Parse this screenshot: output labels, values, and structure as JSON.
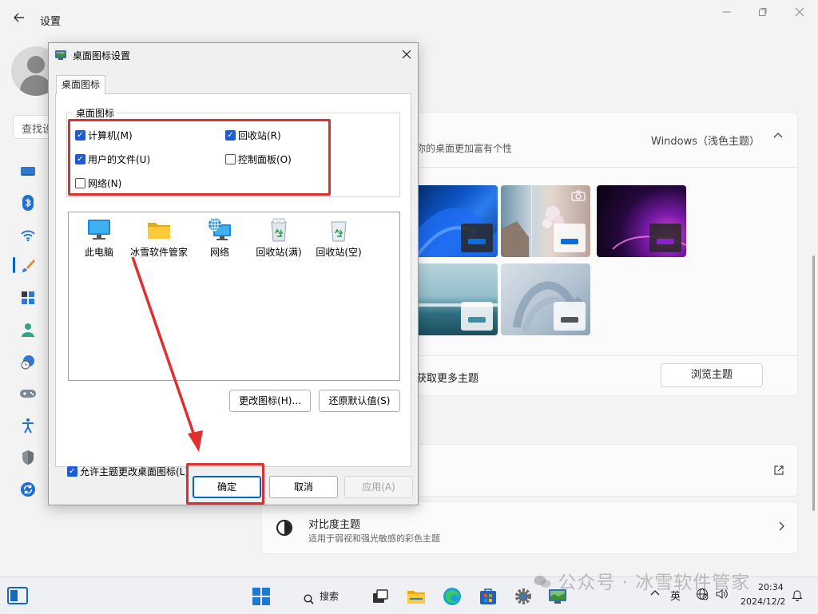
{
  "settings": {
    "title": "设置",
    "search_text": "查找设置",
    "theme": {
      "description": "你的桌面更加富有个性",
      "current": "Windows（浅色主题）",
      "more": "获取更多主题",
      "browse": "浏览主题"
    },
    "contrast": {
      "title": "对比度主题",
      "desc": "适用于弱视和强光敏感的彩色主题"
    }
  },
  "dialog": {
    "title": "桌面图标设置",
    "tab": "桌面图标",
    "group_label": "桌面图标",
    "checkboxes": [
      {
        "label": "计算机(M)",
        "checked": true
      },
      {
        "label": "回收站(R)",
        "checked": true
      },
      {
        "label": "用户的文件(U)",
        "checked": true
      },
      {
        "label": "控制面板(O)",
        "checked": false
      },
      {
        "label": "网络(N)",
        "checked": false
      }
    ],
    "icons": [
      {
        "label": "此电脑"
      },
      {
        "label": "冰雪软件管家"
      },
      {
        "label": "网络"
      },
      {
        "label": "回收站(满)"
      },
      {
        "label": "回收站(空)"
      }
    ],
    "change_icon": "更改图标(H)...",
    "restore_default": "还原默认值(S)",
    "allow_themes": {
      "label": "允许主题更改桌面图标(L)",
      "checked": true
    },
    "ok": "确定",
    "cancel": "取消",
    "apply": "应用(A)"
  },
  "taskbar": {
    "search": "搜索",
    "ime": "英",
    "time": "20:34",
    "date": "2024/12/2"
  },
  "watermark": "公众号 · 冰雪软件管家",
  "colors": {
    "accent": "#0067c0",
    "checkbox": "#1e5bd6",
    "highlight": "#e02f2f"
  }
}
